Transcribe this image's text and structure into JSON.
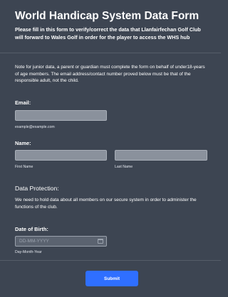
{
  "header": {
    "title": "World Handicap System Data Form",
    "subtitle": "Please fill in this form to verify/correct the data that Llanfairfechan Golf Club will forward to Wales Golf in order for the player to access the WHS hub"
  },
  "note": "Note for junior data, a parent or guardian must complete the form on behalf of under18-years of age members.  The email address/contact number proved below must be that of the responsible adult, not the child.",
  "email": {
    "label": "Email:",
    "value": "",
    "hint": "example@example.com"
  },
  "name": {
    "label": "Name:",
    "first_value": "",
    "last_value": "",
    "first_label": "First Name",
    "last_label": "Last Name"
  },
  "data_protection": {
    "heading": "Data Protection:",
    "text": "We need to hold data about all members on our secure system in order to administer the functions of the club."
  },
  "dob": {
    "label": "Date of Birth:",
    "placeholder": "DD-MM-YYYY",
    "hint": "Day-Month-Year",
    "icon": "calendar-icon"
  },
  "footer": {
    "submit_label": "Submit"
  },
  "colors": {
    "background": "#3d4552",
    "accent": "#2f6fff"
  }
}
